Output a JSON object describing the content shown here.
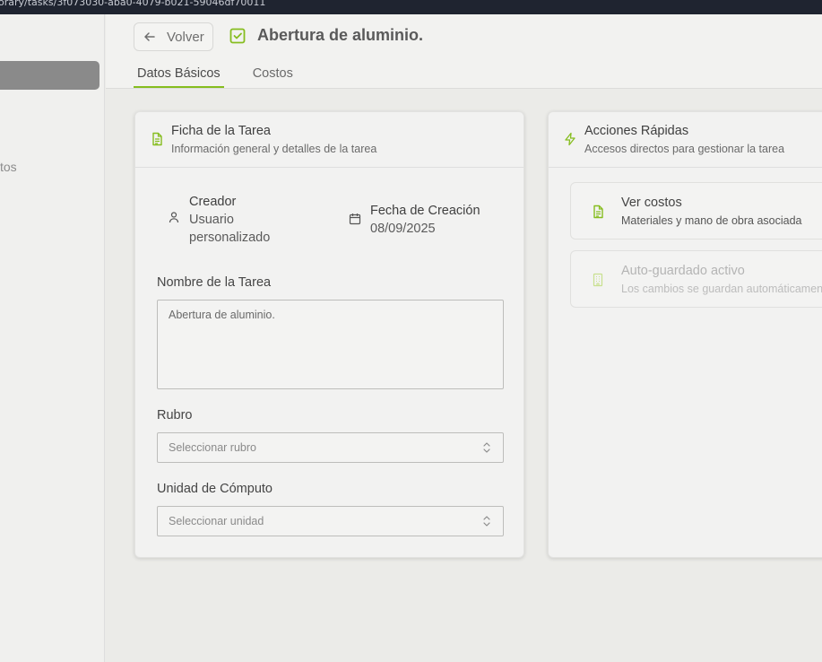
{
  "browser": {
    "url_fragment": "orary/tasks/3f073030-aba0-4079-b021-59046df70011"
  },
  "sidebar": {
    "partial_item": "tos"
  },
  "header": {
    "back_label": "Volver",
    "title": "Abertura de aluminio.",
    "tabs": [
      {
        "label": "Datos Básicos",
        "active": true
      },
      {
        "label": "Costos",
        "active": false
      }
    ]
  },
  "ficha": {
    "title": "Ficha de la Tarea",
    "subtitle": "Información general y detalles de la tarea",
    "creator_label": "Creador",
    "creator_value": "Usuario personalizado",
    "created_label": "Fecha de Creación",
    "created_value": "08/09/2025",
    "name_label": "Nombre de la Tarea",
    "name_value": "Abertura de aluminio.",
    "rubro_label": "Rubro",
    "rubro_placeholder": "Seleccionar rubro",
    "unidad_label": "Unidad de Cómputo",
    "unidad_placeholder": "Seleccionar unidad"
  },
  "acciones": {
    "title": "Acciones Rápidas",
    "subtitle": "Accesos directos para gestionar la tarea",
    "items": [
      {
        "title": "Ver costos",
        "subtitle": "Materiales y mano de obra asociada",
        "enabled": true
      },
      {
        "title": "Auto-guardado activo",
        "subtitle": "Los cambios se guardan automáticamente",
        "enabled": false
      }
    ]
  },
  "colors": {
    "accent": "#86bd1f",
    "sidebar_active": "#8a8a8a",
    "background": "#ebebe8"
  }
}
